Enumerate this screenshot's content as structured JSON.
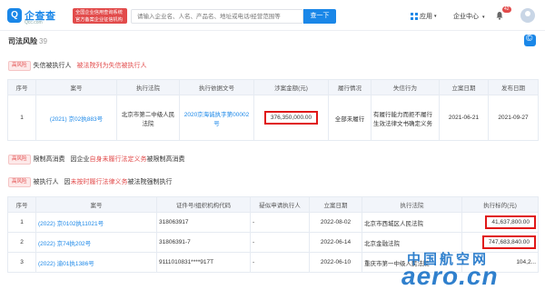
{
  "header": {
    "logo_text": "企查查",
    "logo_url": "Qcc.com",
    "badge_text": "全国企业信用查询系统 官方备案企业征信机构",
    "search_placeholder": "请输入企业名、人名、产品名、地址或电话/经营范围等",
    "search_button": "查一下",
    "nav_app": "应用",
    "nav_enterprise": "企业中心",
    "notification_count": "42"
  },
  "section": {
    "title": "司法风险",
    "count": "39"
  },
  "block1": {
    "tag": "高风险",
    "text_prefix": "失信被执行人",
    "text_highlight": "被法院列为失信被执行人",
    "columns": [
      "序号",
      "案号",
      "执行法院",
      "执行依据文号",
      "涉案金额(元)",
      "履行情况",
      "失信行为",
      "立案日期",
      "发布日期"
    ],
    "rows": [
      {
        "no": "1",
        "case_no": "(2021) 京02执883号",
        "court": "北京市第二中级人民法院",
        "basis": "2020京海诚执字第00002号",
        "amount": "376,350,000.00",
        "status": "全部未履行",
        "behavior": "有履行能力而拒不履行生效法律文书确定义务",
        "filed": "2021-06-21",
        "published": "2021-09-27"
      }
    ]
  },
  "block2": {
    "tag": "高风险",
    "text_prefix": "限制高消费",
    "text_mid": "因企业",
    "text_highlight": "自身未履行法定义务",
    "text_suffix": "被限制高消费"
  },
  "block3": {
    "tag": "高风险",
    "text_prefix": "被执行人",
    "text_mid": "因",
    "text_highlight": "未按时履行法律义务",
    "text_suffix": "被法院强制执行",
    "columns": [
      "序号",
      "案号",
      "证件号/组织机构代码",
      "疑似申请执行人",
      "立案日期",
      "执行法院",
      "执行标的(元)"
    ],
    "rows": [
      {
        "no": "1",
        "case_no": "(2022) 京0102执11021号",
        "id": "318063917",
        "applicant": "-",
        "filed": "2022-08-02",
        "court": "北京市西城区人民法院",
        "amount": "41,637,800.00"
      },
      {
        "no": "2",
        "case_no": "(2022) 京74执202号",
        "id": "31806391-7",
        "applicant": "-",
        "filed": "2022-06-14",
        "court": "北京金融法院",
        "amount": "747,683,840.00"
      },
      {
        "no": "3",
        "case_no": "(2022) 渝01执1386号",
        "id": "9111010831****917T",
        "applicant": "-",
        "filed": "2022-06-10",
        "court": "重庆市第一中级人民法院",
        "amount": "104,2..."
      }
    ]
  },
  "watermark": {
    "cn": "中国航空网",
    "en": "aero.cn"
  },
  "colors": {
    "brand": "#1a87e8",
    "risk_red": "#e24b4b",
    "highlight_box": "#e01818"
  }
}
